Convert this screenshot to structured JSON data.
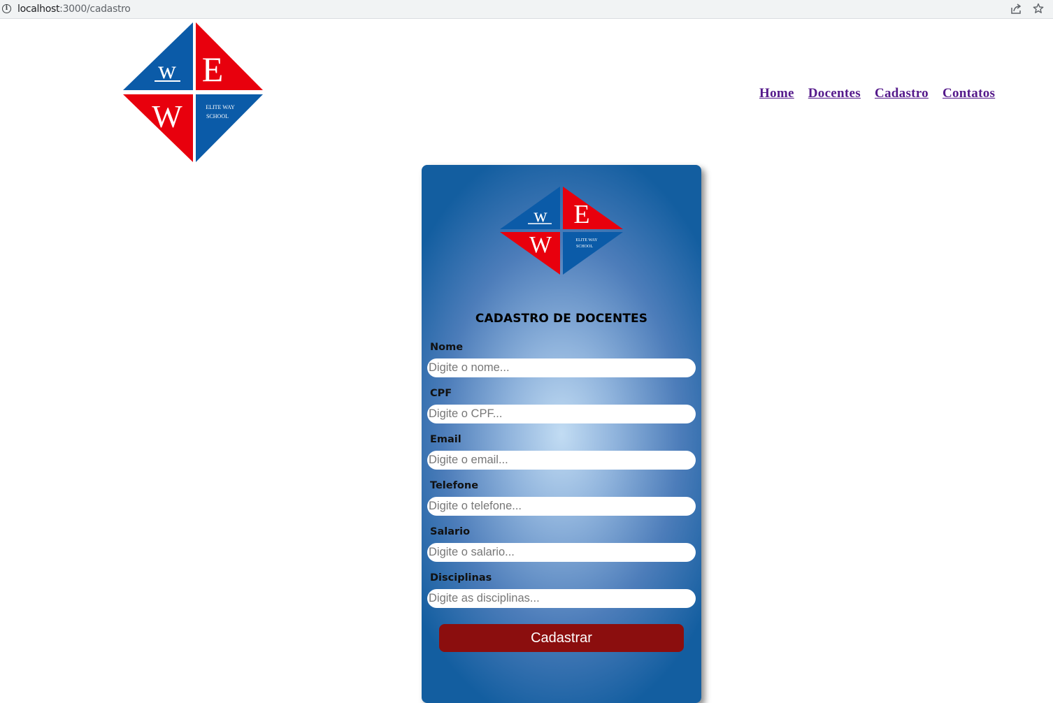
{
  "browser": {
    "url_host": "localhost",
    "url_path": ":3000/cadastro"
  },
  "logo": {
    "letters": [
      "w",
      "E",
      "W"
    ],
    "tagline_line1": "ELITE WAY",
    "tagline_line2": "SCHOOL",
    "colors": {
      "blue": "#0b5ba8",
      "red": "#e8000d"
    }
  },
  "nav": {
    "items": [
      {
        "label": "Home"
      },
      {
        "label": "Docentes"
      },
      {
        "label": "Cadastro"
      },
      {
        "label": "Contatos"
      }
    ]
  },
  "form": {
    "title": "CADASTRO DE DOCENTES",
    "fields": [
      {
        "label": "Nome",
        "placeholder": "Digite o nome...",
        "value": ""
      },
      {
        "label": "CPF",
        "placeholder": "Digite o CPF...",
        "value": ""
      },
      {
        "label": "Email",
        "placeholder": "Digite o email...",
        "value": ""
      },
      {
        "label": "Telefone",
        "placeholder": "Digite o telefone...",
        "value": ""
      },
      {
        "label": "Salario",
        "placeholder": "Digite o salario...",
        "value": ""
      },
      {
        "label": "Disciplinas",
        "placeholder": "Digite as disciplinas...",
        "value": ""
      }
    ],
    "submit_label": "Cadastrar",
    "button_color": "#8b0e0e"
  }
}
